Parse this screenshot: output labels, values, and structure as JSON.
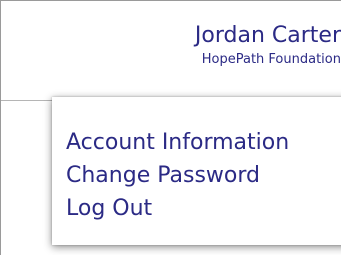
{
  "user": {
    "name": "Jordan Carter",
    "organization": "HopePath Foundation"
  },
  "menu": {
    "items": [
      {
        "label": "Account Information"
      },
      {
        "label": "Change Password"
      },
      {
        "label": "Log Out"
      }
    ]
  },
  "colors": {
    "text_accent": "#2b2a85",
    "divider": "#b5b5b5"
  }
}
